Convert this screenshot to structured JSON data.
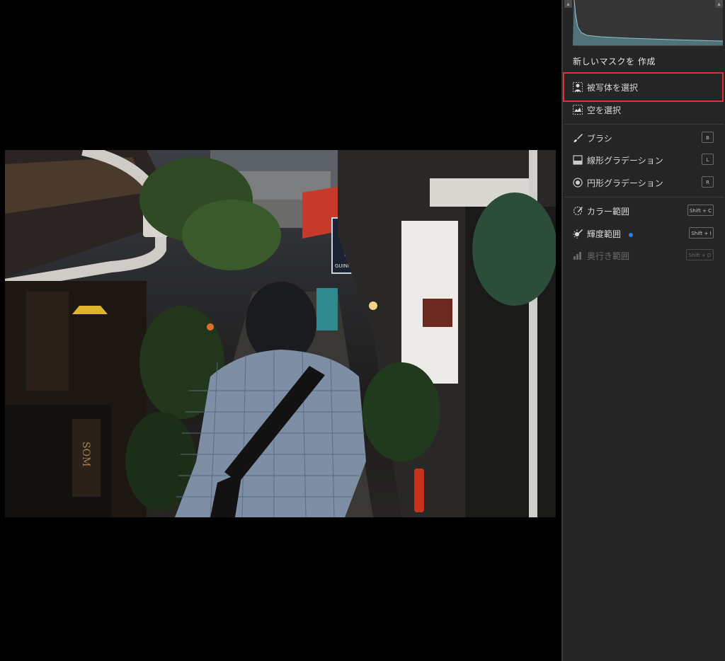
{
  "colors": {
    "panel_bg": "#252525",
    "highlight_border": "#e0303a",
    "badge_dot": "#2f7fe0",
    "text": "#d6d6d6"
  },
  "photo": {
    "signs": {
      "guinness": "GUINNESS",
      "vertical_sign": "SOM"
    }
  },
  "panel": {
    "histogram": {
      "left_button": "▴",
      "right_button": "▴"
    },
    "new_mask_title": "新しいマスクを 作成",
    "items": [
      {
        "id": "select-subject",
        "icon": "person-silhouette-icon",
        "label": "被写体を選択",
        "shortcut": "",
        "highlighted": true
      },
      {
        "id": "select-sky",
        "icon": "sky-icon",
        "label": "空を選択",
        "shortcut": ""
      },
      {
        "id": "brush",
        "icon": "brush-icon",
        "label": "ブラシ",
        "shortcut": "B"
      },
      {
        "id": "linear-gradient",
        "icon": "linear-gradient-icon",
        "label": "線形グラデーション",
        "shortcut": "L"
      },
      {
        "id": "radial-gradient",
        "icon": "radial-gradient-icon",
        "label": "円形グラデーション",
        "shortcut": "R"
      },
      {
        "id": "color-range",
        "icon": "color-range-icon",
        "label": "カラー範囲",
        "shortcut": "Shift + C"
      },
      {
        "id": "luminance-range",
        "icon": "luminance-range-icon",
        "label": "輝度範囲",
        "shortcut": "Shift + I",
        "new_badge": true
      },
      {
        "id": "depth-range",
        "icon": "depth-range-icon",
        "label": "奥行き範囲",
        "shortcut": "Shift + D",
        "disabled": true
      }
    ]
  }
}
